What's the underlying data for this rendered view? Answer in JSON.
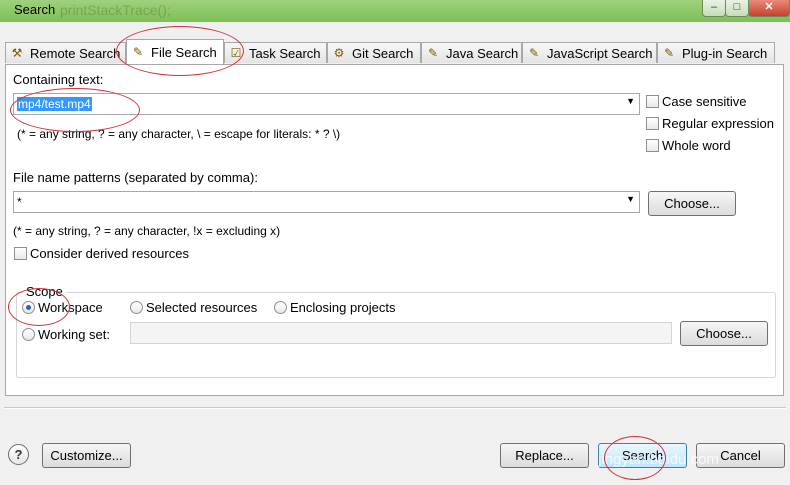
{
  "window": {
    "title": "Search",
    "ghost_title": "printStackTrace();",
    "min_glyph": "–",
    "max_glyph": "□",
    "close_glyph": "✕"
  },
  "tabs": [
    {
      "label": "Remote Search",
      "icon": "remote-search-icon",
      "active": false
    },
    {
      "label": "File Search",
      "icon": "file-search-icon",
      "active": true
    },
    {
      "label": "Task Search",
      "icon": "task-search-icon",
      "active": false
    },
    {
      "label": "Git Search",
      "icon": "git-search-icon",
      "active": false
    },
    {
      "label": "Java Search",
      "icon": "java-search-icon",
      "active": false
    },
    {
      "label": "JavaScript Search",
      "icon": "javascript-search-icon",
      "active": false
    },
    {
      "label": "Plug-in Search",
      "icon": "plugin-search-icon",
      "active": false
    }
  ],
  "containing": {
    "label": "Containing text:",
    "value": "mp4/test.mp4",
    "hint": "(* = any string, ? = any character, \\ = escape for literals: * ? \\)",
    "case_sensitive": "Case sensitive",
    "regex": "Regular expression",
    "whole_word": "Whole word"
  },
  "patterns": {
    "label": "File name patterns (separated by comma):",
    "value": "*",
    "hint": "(* = any string, ? = any character, !x = excluding x)",
    "choose": "Choose...",
    "derived": "Consider derived resources"
  },
  "scope": {
    "legend": "Scope",
    "workspace": "Workspace",
    "selected": "Selected resources",
    "enclosing": "Enclosing projects",
    "working_set": "Working set:",
    "choose": "Choose..."
  },
  "footer": {
    "help": "?",
    "customize": "Customize...",
    "replace": "Replace...",
    "search": "Search",
    "cancel": "Cancel",
    "watermark": "jingyan.baidu.com"
  },
  "colors": {
    "annotation": "#d0323b",
    "selection": "#3399ff",
    "titlebar": "#8cc865"
  }
}
